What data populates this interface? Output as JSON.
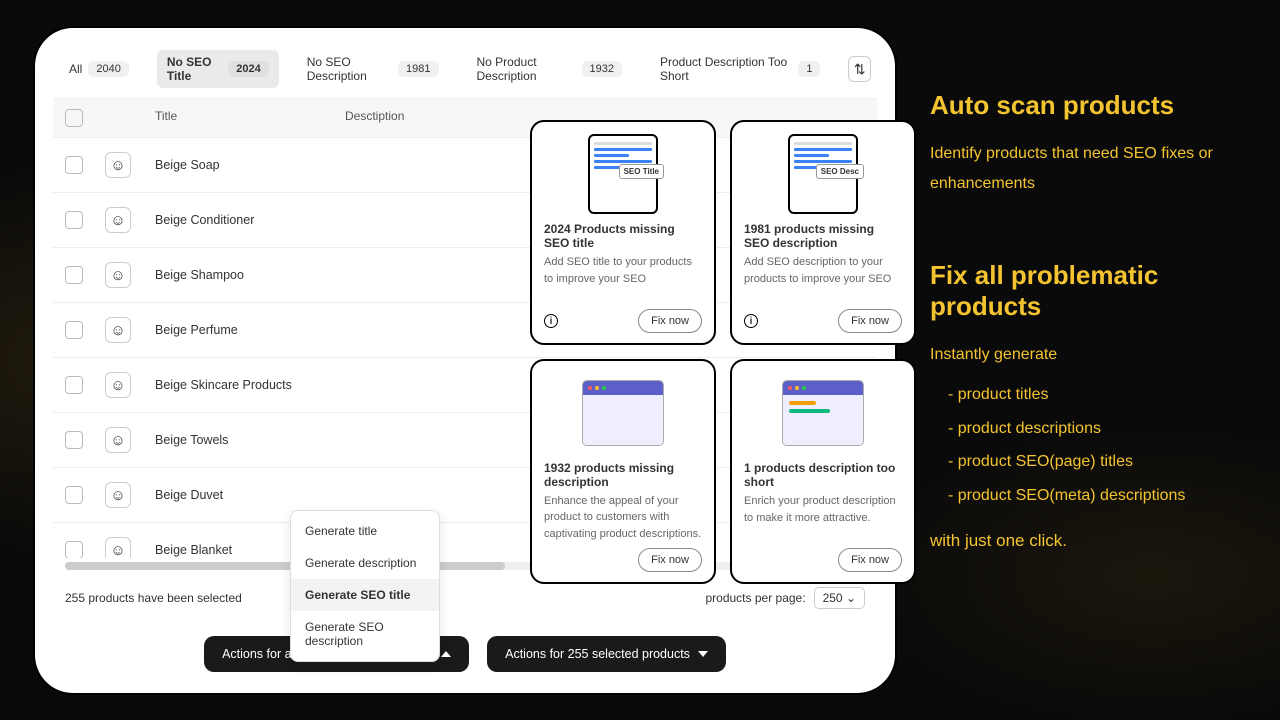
{
  "tabs": {
    "all": {
      "label": "All",
      "count": "2040"
    },
    "no_seo_title": {
      "label": "No SEO Title",
      "count": "2024"
    },
    "no_seo_desc": {
      "label": "No SEO Description",
      "count": "1981"
    },
    "no_prod_desc": {
      "label": "No Product Description",
      "count": "1932"
    },
    "desc_short": {
      "label": "Product Description Too Short",
      "count": "1"
    }
  },
  "columns": {
    "title": "Title",
    "desc": "Desctiption"
  },
  "products": [
    {
      "title": "Beige Soap"
    },
    {
      "title": "Beige Conditioner"
    },
    {
      "title": "Beige Shampoo"
    },
    {
      "title": "Beige Perfume"
    },
    {
      "title": "Beige Skincare Products"
    },
    {
      "title": "Beige Towels"
    },
    {
      "title": "Beige Duvet"
    },
    {
      "title": "Beige Blanket"
    }
  ],
  "selection_text": "255 products have been selected",
  "perpage_label": "products per page:",
  "perpage_value": "250",
  "dropdown_title": "Actions",
  "menu": {
    "gen_title": "Generate title",
    "gen_desc": "Generate description",
    "gen_seo_title": "Generate SEO title",
    "gen_seo_desc": "Generate SEO description"
  },
  "action_all": "Actions for all \"No SEO Title\" products",
  "action_selected": "Actions for 255 selected products",
  "cards": {
    "seo_title": {
      "tag": "SEO Title",
      "title": "2024 Products missing SEO title",
      "desc": "Add SEO title to your products to improve your SEO",
      "btn": "Fix now"
    },
    "seo_desc": {
      "tag": "SEO Desc",
      "title": "1981 products missing SEO description",
      "desc": "Add SEO description to your products to improve your SEO",
      "btn": "Fix now"
    },
    "prod_desc": {
      "title": "1932 products missing description",
      "desc": "Enhance the appeal of your product to customers with captivating product descriptions.",
      "btn": "Fix now"
    },
    "desc_short": {
      "title": "1 products description too short",
      "desc": "Enrich your product description to make it more attractive.",
      "btn": "Fix now"
    }
  },
  "right": {
    "h1": "Auto scan products",
    "p1": "Identify products that need SEO fixes or enhancements",
    "h2": "Fix all problematic products",
    "p2_lead": "Instantly generate",
    "bullets": [
      "product titles",
      "product descriptions",
      "product SEO(page) titles",
      "product SEO(meta) descriptions"
    ],
    "closing": "with just one click."
  }
}
